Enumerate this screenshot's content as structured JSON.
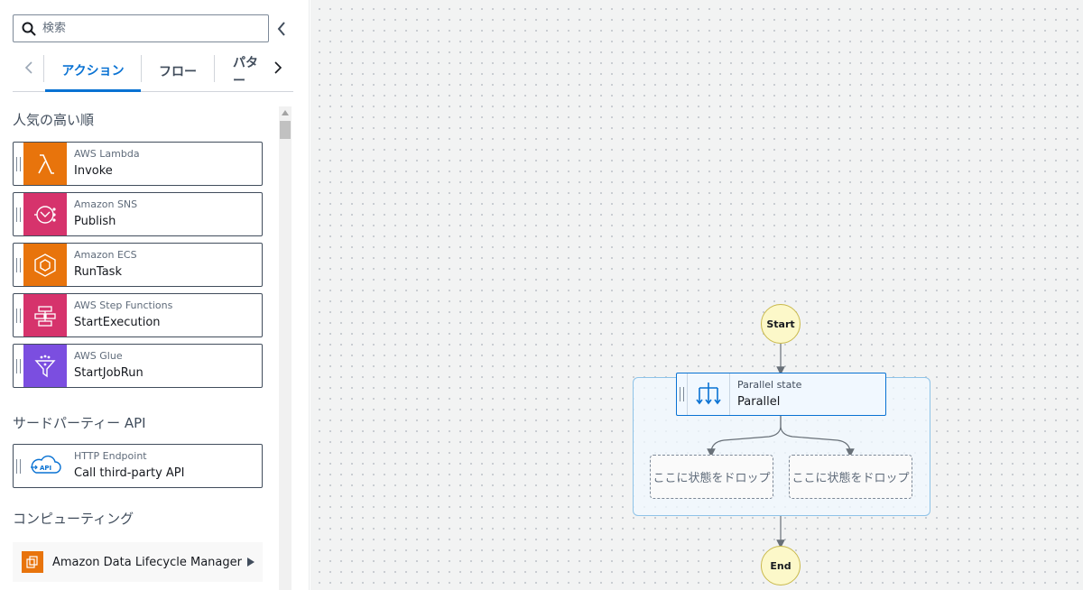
{
  "search": {
    "placeholder": "検索"
  },
  "tabs": [
    {
      "label": "アクション",
      "active": true
    },
    {
      "label": "フロー",
      "active": false
    },
    {
      "label": "パター",
      "active": false
    }
  ],
  "sections": {
    "popular": "人気の高い順",
    "third_party": "サードパーティー API",
    "compute": "コンピューティング"
  },
  "popular_cards": [
    {
      "service": "AWS Lambda",
      "action": "Invoke",
      "icon": "lambda-icon",
      "color": "#e8740c"
    },
    {
      "service": "Amazon SNS",
      "action": "Publish",
      "icon": "sns-icon",
      "color": "#d6336c"
    },
    {
      "service": "Amazon ECS",
      "action": "RunTask",
      "icon": "ecs-icon",
      "color": "#e8740c"
    },
    {
      "service": "AWS Step Functions",
      "action": "StartExecution",
      "icon": "step-functions-icon",
      "color": "#d6336c"
    },
    {
      "service": "AWS Glue",
      "action": "StartJobRun",
      "icon": "glue-icon",
      "color": "#7b4ee0"
    }
  ],
  "third_party_card": {
    "service": "HTTP Endpoint",
    "action": "Call third-party API",
    "icon": "api-cloud-icon",
    "icon_text": "API"
  },
  "compute_item": {
    "label": "Amazon Data Lifecycle Manager",
    "icon": "data-lifecycle-icon",
    "color": "#e8740c"
  },
  "flow": {
    "start_label": "Start",
    "end_label": "End",
    "parallel": {
      "type_label": "Parallel state",
      "name": "Parallel"
    },
    "drop_zones": [
      "ここに状態をドロップ",
      "ここに状態をドロップ"
    ]
  },
  "colors": {
    "accent": "#0972d3",
    "start_end_fill": "#fcf8c9"
  }
}
